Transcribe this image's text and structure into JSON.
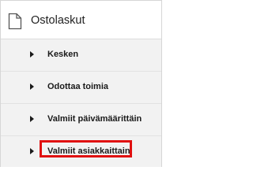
{
  "header": {
    "title": "Ostolaskut",
    "icon": "document-icon"
  },
  "menu": {
    "items": [
      {
        "label": "Kesken",
        "icon": "caret-right-icon"
      },
      {
        "label": "Odottaa toimia",
        "icon": "caret-right-icon"
      },
      {
        "label": "Valmiit päivämäärittäin",
        "icon": "caret-right-icon"
      },
      {
        "label": "Valmiit asiakkaittain",
        "icon": "caret-right-icon",
        "highlighted": true
      }
    ]
  },
  "colors": {
    "highlight": "#e01010",
    "item_background": "#f2f2f2",
    "text": "#1a1a1a"
  }
}
